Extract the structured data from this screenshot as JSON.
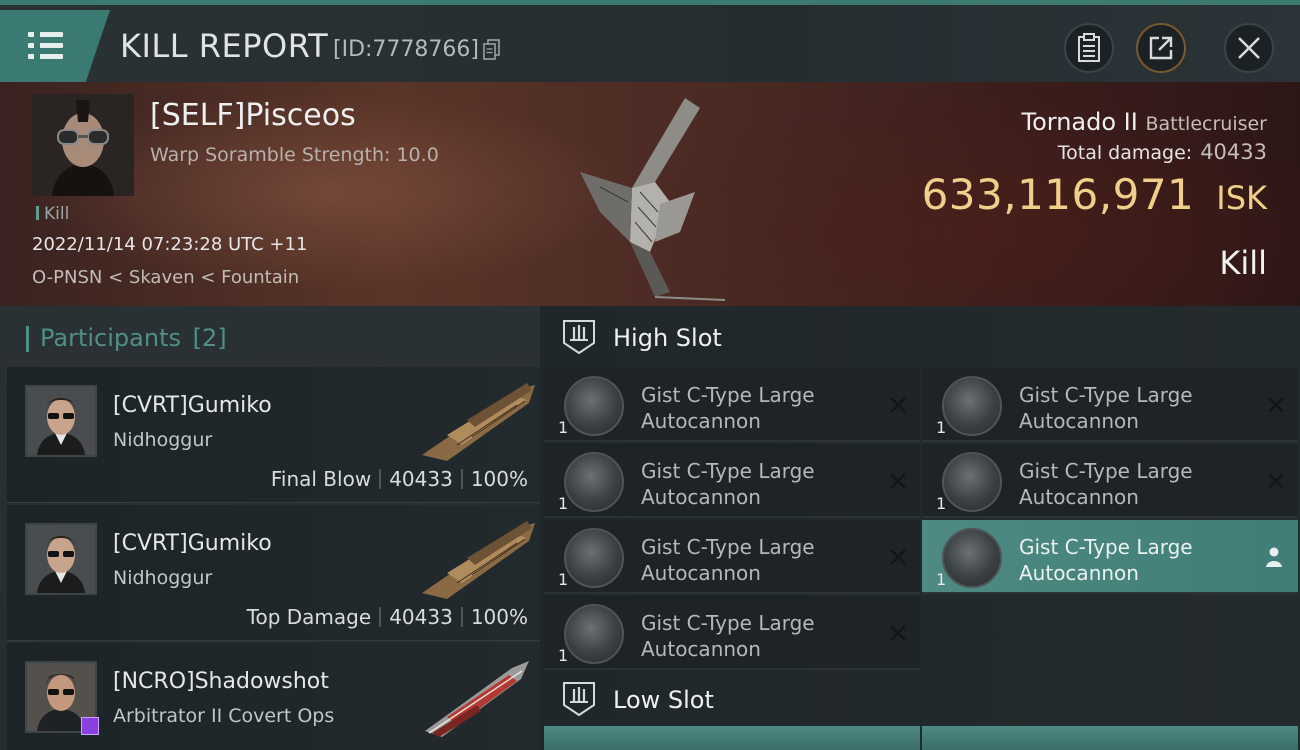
{
  "header": {
    "title": "KILL REPORT",
    "report_id": "[ID:7778766]",
    "icons": {
      "menu": "hamburger-menu-icon",
      "copy": "copy-icon",
      "clipboard": "clipboard-icon",
      "share": "share-icon",
      "close": "close-icon"
    }
  },
  "victim": {
    "name": "[SELF]Pisceos",
    "detail": "Warp Soramble Strength: 10.0",
    "result_tag": "Kill",
    "timestamp": "2022/11/14 07:23:28 UTC +11",
    "location": "O-PNSN < Skaven < Fountain",
    "ship_name": "Tornado II",
    "ship_class": "Battlecruiser",
    "damage_label": "Total damage:",
    "damage_value": "40433",
    "isk_value": "633,116,971",
    "isk_unit": "ISK",
    "result_label": "Kill"
  },
  "participants": {
    "title": "Participants",
    "count": "[2]",
    "rows": [
      {
        "name": "[CVRT]Gumiko",
        "ship": "Nidhoggur",
        "role": "Final Blow",
        "damage": "40433",
        "percent": "100%"
      },
      {
        "name": "[CVRT]Gumiko",
        "ship": "Nidhoggur",
        "role": "Top Damage",
        "damage": "40433",
        "percent": "100%"
      },
      {
        "name": "[NCRO]Shadowshot",
        "ship": "Arbitrator II Covert Ops",
        "role": "",
        "damage": "",
        "percent": ""
      }
    ]
  },
  "fitting": {
    "high_slot_label": "High Slot",
    "low_slot_label": "Low Slot",
    "high_slots": [
      {
        "line1": "Gist C-Type Large",
        "line2": "Autocannon",
        "qty": "1",
        "status": "destroyed"
      },
      {
        "line1": "Gist C-Type Large",
        "line2": "Autocannon",
        "qty": "1",
        "status": "destroyed"
      },
      {
        "line1": "Gist C-Type Large",
        "line2": "Autocannon",
        "qty": "1",
        "status": "destroyed"
      },
      {
        "line1": "Gist C-Type Large",
        "line2": "Autocannon",
        "qty": "1",
        "status": "destroyed"
      },
      {
        "line1": "Gist C-Type Large",
        "line2": "Autocannon",
        "qty": "1",
        "status": "destroyed"
      },
      {
        "line1": "Gist C-Type Large",
        "line2": "Autocannon",
        "qty": "1",
        "status": "dropped"
      },
      {
        "line1": "Gist C-Type Large",
        "line2": "Autocannon",
        "qty": "1",
        "status": "destroyed"
      }
    ]
  },
  "colors": {
    "accent_teal": "#3a7a72",
    "isk_gold": "#f0cf8a",
    "highlight_slot": "#4e8a83",
    "hero_red": "#5a3428"
  }
}
